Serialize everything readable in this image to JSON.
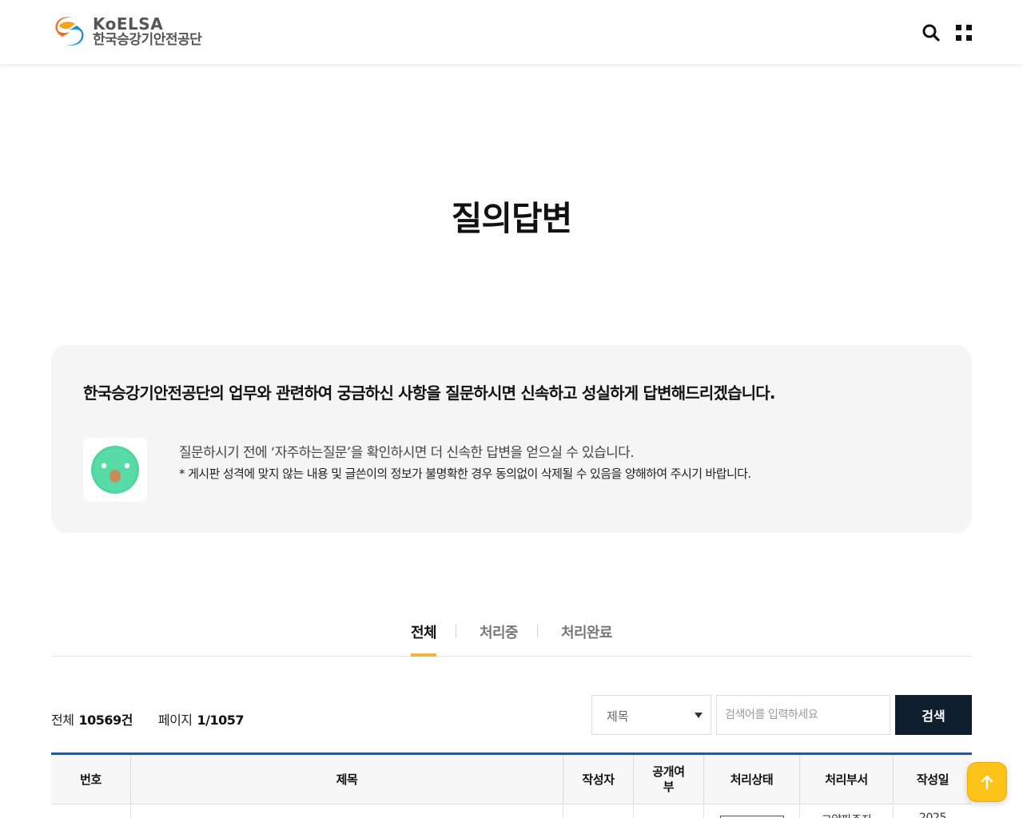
{
  "header": {
    "logo_en": "KoELSA",
    "logo_ko": "한국승강기안전공단",
    "brand_colors": {
      "orange": "#f26b21",
      "blue": "#1f8ecf"
    },
    "search_icon": "search-icon",
    "menu_icon": "grid-menu-icon"
  },
  "page": {
    "title": "질의답변"
  },
  "info": {
    "heading": "한국승강기안전공단의 업무와 관련하여 궁금하신 사항을 질문하시면 신속하고 성실하게 답변해드리겠습니다.",
    "line1": "질문하시기 전에 ‘자주하는질문’을 확인하시면 더 신속한 답변을 얻으실 수 있습니다.",
    "line2": "* 게시판 성격에 맞지 않는 내용 및 글쓴이의 정보가 불명확한 경우 동의없이 삭제될 수 있음을 양해하여 주시기 바랍니다.",
    "icon": "chat-bird-icon"
  },
  "tabs": [
    {
      "label": "전체",
      "active": true
    },
    {
      "label": "처리중",
      "active": false
    },
    {
      "label": "처리완료",
      "active": false
    }
  ],
  "counts": {
    "total_label": "전체",
    "total_value": "10569건",
    "page_label": "페이지",
    "page_value": "1/1057"
  },
  "search": {
    "select_value": "제목",
    "input_placeholder": "검색어를 입력하세요",
    "button_label": "검색"
  },
  "table": {
    "headers": [
      "번호",
      "제목",
      "작성자",
      "공개여\n부",
      "처리상태",
      "처리부서",
      "작성일"
    ],
    "first_row_partial": {
      "dept": "고양파주지",
      "date": "2025"
    }
  },
  "top_button": {
    "icon": "arrow-up-icon",
    "color": "#fcc419"
  }
}
